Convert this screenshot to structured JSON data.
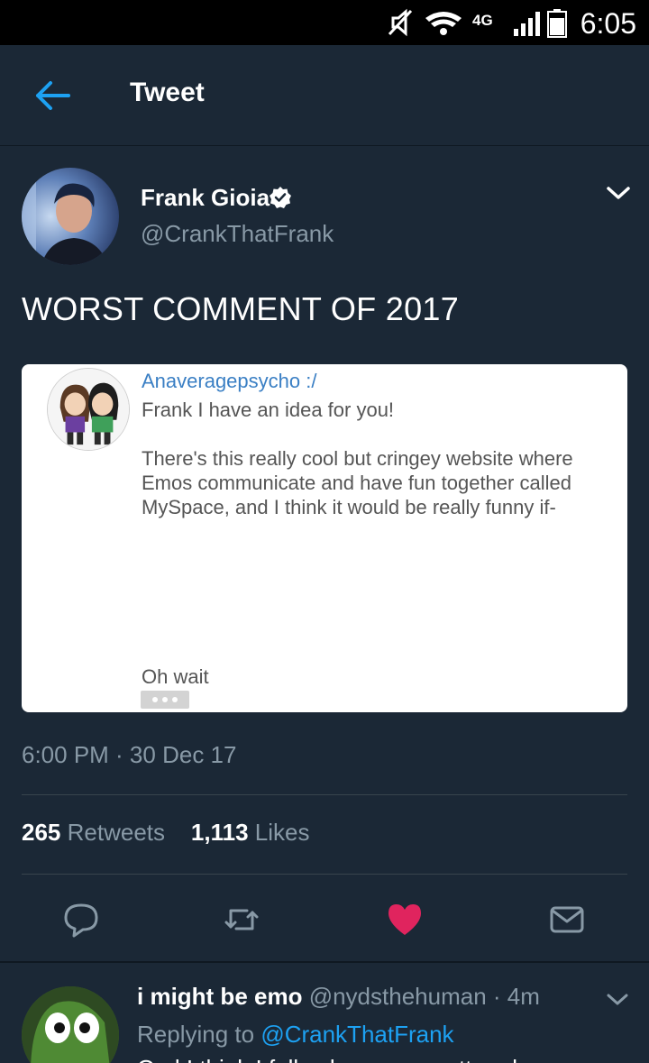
{
  "status_bar": {
    "time": "6:05",
    "network": "4G"
  },
  "app_bar": {
    "title": "Tweet",
    "back_icon": "arrow-left-icon"
  },
  "tweet": {
    "author_name": "Frank Gioia",
    "author_handle": "@CrankThatFrank",
    "text": "WORST COMMENT OF 2017",
    "timestamp": "6:00 PM · 30 Dec 17",
    "retweets_count": "265",
    "retweets_label": "Retweets",
    "likes_count": "1,113",
    "likes_label": "Likes",
    "liked": true,
    "media": {
      "username": "Anaveragepsycho :/",
      "line1": "Frank I have an idea for you!",
      "line2": "There's this really cool but cringey website where",
      "line3": "Emos communicate and have fun together called",
      "line4": "MySpace, and I think it would be really funny if-",
      "line5": "Oh wait"
    }
  },
  "actions": {
    "reply_icon": "speech-bubble-icon",
    "retweet_icon": "retweet-icon",
    "like_icon": "heart-icon",
    "share_icon": "envelope-icon"
  },
  "colors": {
    "background": "#1b2836",
    "accent": "#1da1f2",
    "like": "#e0245e",
    "muted": "#8899a6"
  },
  "reply": {
    "author_name": "i might be emo",
    "author_handle": "@nydsthehuman",
    "time": "· 4m",
    "replying_prefix": "Replying to",
    "replying_to": "@CrankThatFrank",
    "text": "Oml I think I fell asleep on a pattern l"
  }
}
